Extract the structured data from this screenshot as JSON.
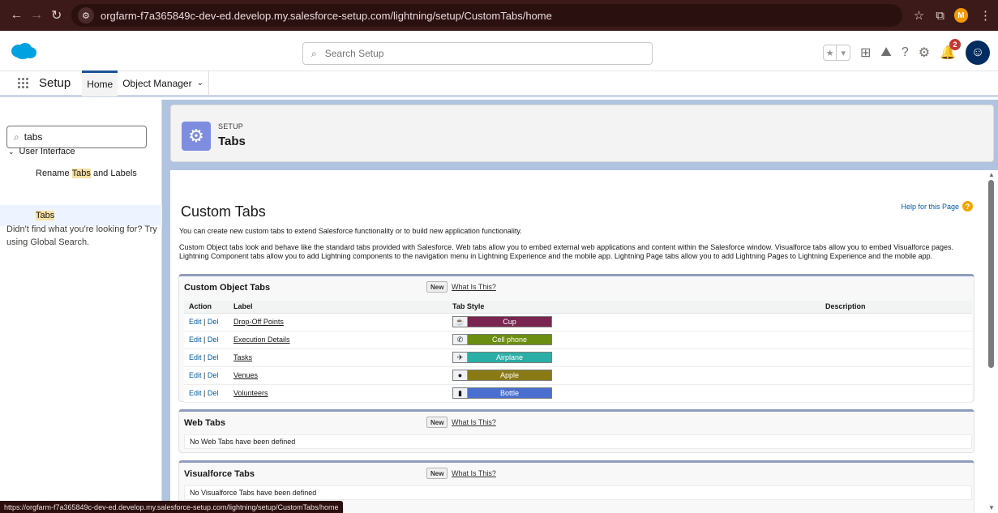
{
  "browser": {
    "url": "orgfarm-f7a365849c-dev-ed.develop.my.salesforce-setup.com/lightning/setup/CustomTabs/home",
    "profile_initial": "M",
    "status_url": "https://orgfarm-f7a365849c-dev-ed.develop.my.salesforce-setup.com/lightning/setup/CustomTabs/home"
  },
  "header": {
    "search_placeholder": "Search Setup",
    "notification_count": "2"
  },
  "appnav": {
    "app_name": "Setup",
    "tabs": [
      {
        "label": "Home"
      },
      {
        "label": "Object Manager"
      }
    ]
  },
  "sidebar": {
    "quickfind_value": "tabs",
    "group_label": "User Interface",
    "items": [
      {
        "before": "Rename ",
        "match": "Tabs",
        "after": " and Labels"
      },
      {
        "before": "",
        "match": "Tabs",
        "after": ""
      }
    ],
    "hint": "Didn't find what you're looking for? Try using Global Search."
  },
  "page_header": {
    "eyebrow": "SETUP",
    "title": "Tabs"
  },
  "content": {
    "title": "Custom Tabs",
    "help_link": "Help for this Page",
    "intro": "You can create new custom tabs to extend Salesforce functionality or to build new application functionality.",
    "description": "Custom Object tabs look and behave like the standard tabs provided with Salesforce. Web tabs allow you to embed external web applications and content within the Salesforce window. Visualforce tabs allow you to embed Visualforce pages. Lightning Component tabs allow you to add Lightning components to the navigation menu in Lightning Experience and the mobile app. Lightning Page tabs allow you to add Lightning Pages to Lightning Experience and the mobile app."
  },
  "custom_object_tabs": {
    "title": "Custom Object Tabs",
    "new_label": "New",
    "what_label": "What Is This?",
    "columns": [
      "Action",
      "Label",
      "Tab Style",
      "Description"
    ],
    "edit_label": "Edit",
    "sep": "|",
    "del_label": "Del",
    "rows": [
      {
        "label": "Drop-Off Points",
        "style": "Cup",
        "color": "#7a2550",
        "icon": "☕"
      },
      {
        "label": "Execution Details",
        "style": "Cell phone",
        "color": "#6b8e10",
        "icon": "✆"
      },
      {
        "label": "Tasks",
        "style": "Airplane",
        "color": "#2aaea6",
        "icon": "✈"
      },
      {
        "label": "Venues",
        "style": "Apple",
        "color": "#8a7a16",
        "icon": "●"
      },
      {
        "label": "Volunteers",
        "style": "Bottle",
        "color": "#4a6fd0",
        "icon": "▮"
      }
    ]
  },
  "web_tabs": {
    "title": "Web Tabs",
    "new_label": "New",
    "what_label": "What Is This?",
    "empty": "No Web Tabs have been defined"
  },
  "visualforce_tabs": {
    "title": "Visualforce Tabs",
    "new_label": "New",
    "what_label": "What Is This?",
    "empty": "No Visualforce Tabs have been defined"
  }
}
